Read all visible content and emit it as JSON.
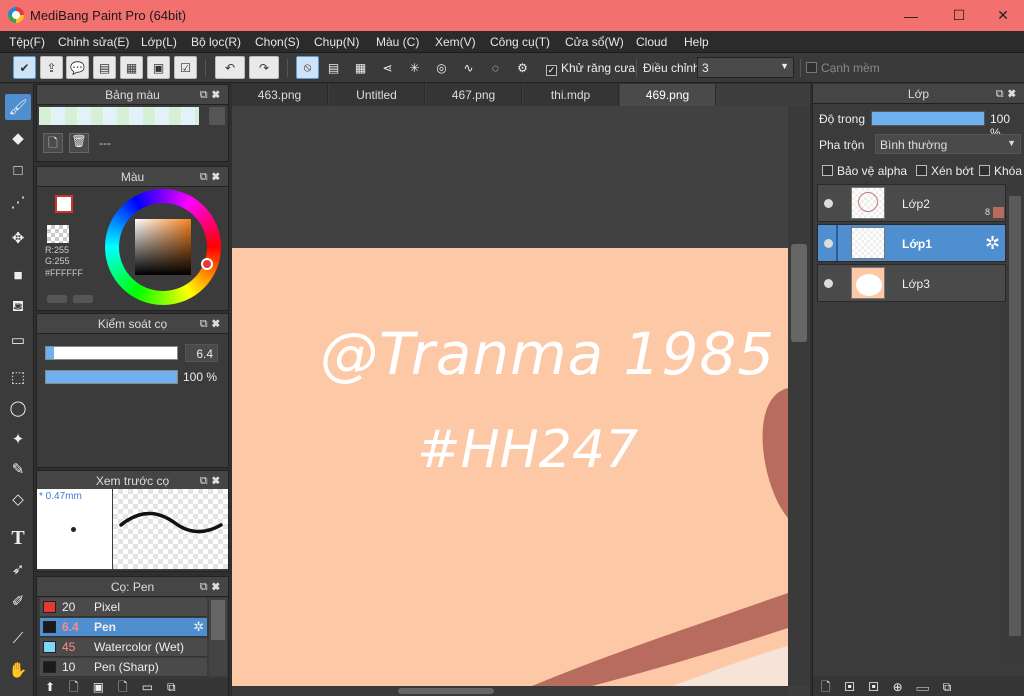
{
  "window": {
    "title": "MediBang Paint Pro (64bit)",
    "min": "—",
    "max": "☐",
    "close": "✕"
  },
  "menu": [
    "Tệp(F)",
    "Chỉnh sửa(E)",
    "Lớp(L)",
    "Bộ lọc(R)",
    "Chọn(S)",
    "Chụp(N)",
    "Màu (C)",
    "Xem(V)",
    "Công cụ(T)",
    "Cửa sổ(W)",
    "Cloud",
    "Help"
  ],
  "toolbar": {
    "antialias_label": "Khử răng cưa",
    "correction_label": "Điều chỉnh",
    "correction_value": "3",
    "soft_edge_label": "Cạnh mềm"
  },
  "palette_panel": {
    "title": "Bảng màu",
    "name": "---"
  },
  "color_panel": {
    "title": "Màu",
    "r": "R:255",
    "g": "G:255",
    "hex": "#FFFFFF"
  },
  "brush_control": {
    "title": "Kiểm soát cọ",
    "size": "6.4",
    "size_fraction": 0.064,
    "opacity": "100 %",
    "opacity_fraction": 1.0
  },
  "brush_preview": {
    "title": "Xem trước cọ",
    "size_text": "* 0.47mm"
  },
  "brush_list": {
    "title": "Cọ: Pen",
    "items": [
      {
        "size": "20",
        "name": "Pixel",
        "color": "#e53935"
      },
      {
        "size": "6.4",
        "name": "Pen",
        "color": "#1b1b1b"
      },
      {
        "size": "45",
        "name": "Watercolor (Wet)",
        "color": "#7fd6f5"
      },
      {
        "size": "10",
        "name": "Pen (Sharp)",
        "color": "#1b1b1b"
      }
    ]
  },
  "tabs": [
    "463.png",
    "Untitled",
    "467.png",
    "thi.mdp",
    "469.png"
  ],
  "canvas_text": {
    "line1": "@Tranma 1985",
    "line2": "#HH247"
  },
  "layer_panel": {
    "title": "Lớp",
    "opacity_label": "Độ trong",
    "opacity_value": "100 %",
    "opacity_fraction": 1.0,
    "blend_label": "Pha trộn",
    "blend_value": "Bình thường",
    "protect_alpha": "Bảo vệ alpha",
    "clip": "Xén bớt",
    "lock": "Khóa",
    "layers": [
      {
        "name": "Lớp2",
        "badge": "8"
      },
      {
        "name": "Lớp1"
      },
      {
        "name": "Lớp3"
      }
    ]
  },
  "colors": {
    "accent": "#4f8fd0",
    "title_bar": "#f2706e",
    "canvas_bg": "#fdc8a5",
    "shape": "#b86b5f"
  }
}
